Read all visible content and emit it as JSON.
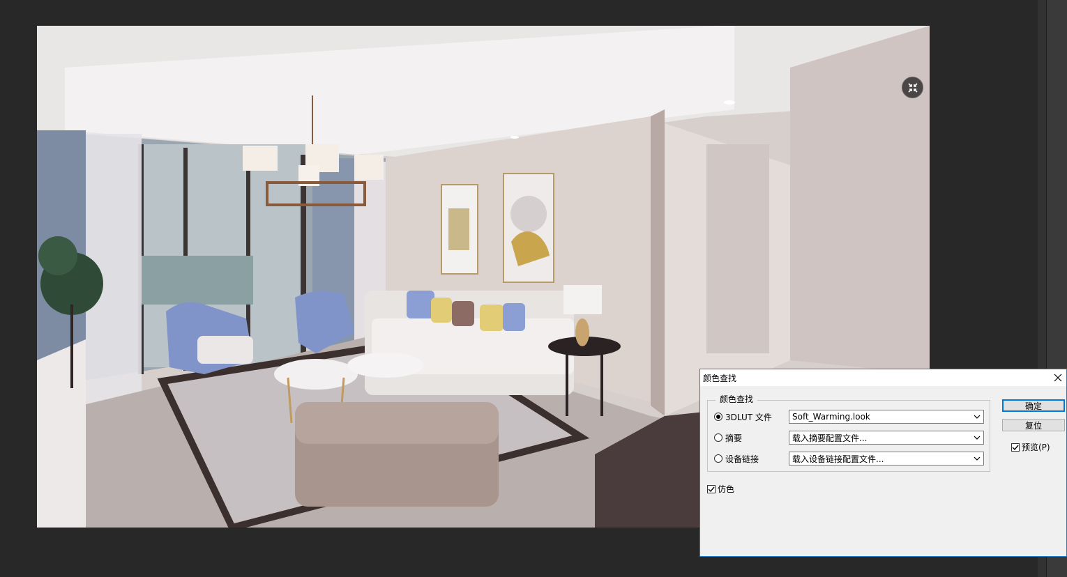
{
  "dialog": {
    "title": "颜色查找",
    "group_label": "颜色查找",
    "options": [
      {
        "label": "3DLUT 文件",
        "checked": true,
        "value": "Soft_Warming.look"
      },
      {
        "label": "摘要",
        "checked": false,
        "value": "载入摘要配置文件..."
      },
      {
        "label": "设备链接",
        "checked": false,
        "value": "载入设备链接配置文件..."
      }
    ],
    "dither_label": "仿色",
    "ok_label": "确定",
    "reset_label": "复位",
    "preview_label": "预览(P)"
  },
  "colors": {
    "accent": "#0078d7",
    "workspace": "#282828",
    "dialog_bg": "#f0f0f0"
  },
  "icons": [
    "collapse-arrows-icon",
    "close-icon",
    "chevron-down-icon",
    "checkmark-icon"
  ]
}
